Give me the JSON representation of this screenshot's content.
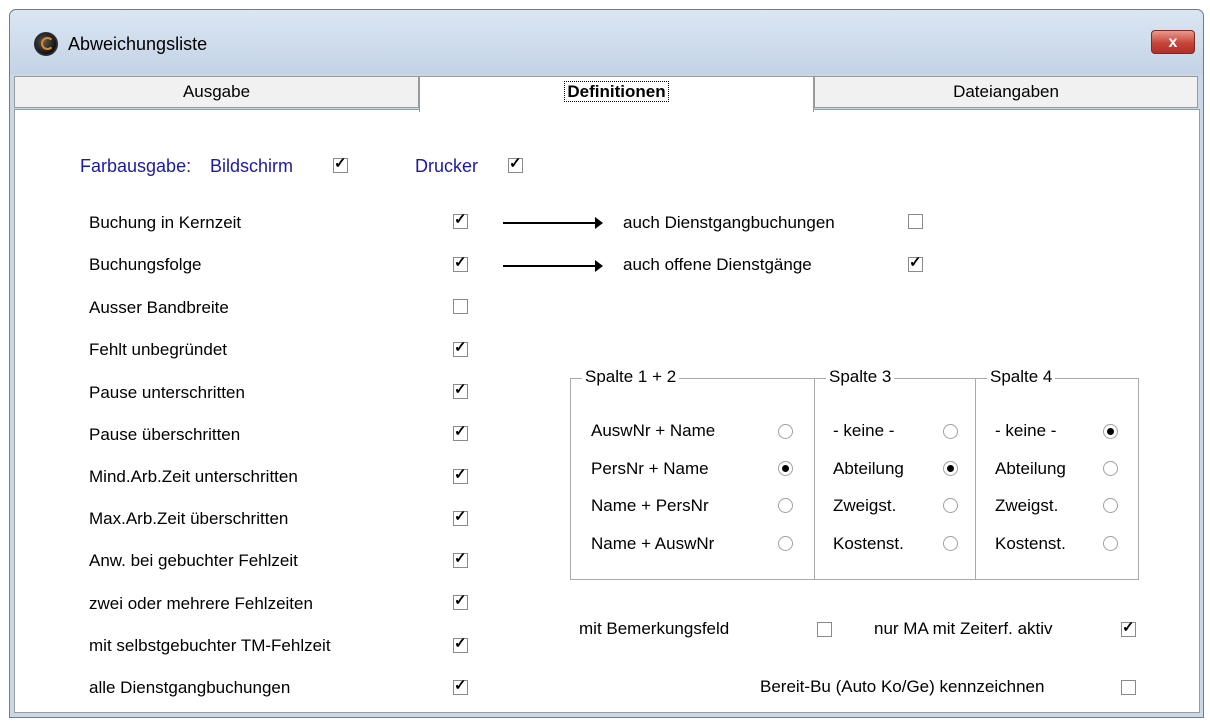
{
  "window": {
    "title": "Abweichungsliste",
    "close_label": "x"
  },
  "tabs": [
    {
      "label": "Ausgabe"
    },
    {
      "label": "Definitionen"
    },
    {
      "label": "Dateiangaben"
    }
  ],
  "farbausgabe": {
    "label": "Farbausgabe:",
    "bildschirm_label": "Bildschirm",
    "bildschirm_checked": true,
    "drucker_label": "Drucker",
    "drucker_checked": true
  },
  "checklist": [
    {
      "label": "Buchung in Kernzeit",
      "checked": true
    },
    {
      "label": "Buchungsfolge",
      "checked": true
    },
    {
      "label": "Ausser Bandbreite",
      "checked": false
    },
    {
      "label": "Fehlt unbegründet",
      "checked": true
    },
    {
      "label": "Pause unterschritten",
      "checked": true
    },
    {
      "label": "Pause überschritten",
      "checked": true
    },
    {
      "label": "Mind.Arb.Zeit unterschritten",
      "checked": true
    },
    {
      "label": "Max.Arb.Zeit überschritten",
      "checked": true
    },
    {
      "label": "Anw. bei gebuchter Fehlzeit",
      "checked": true
    },
    {
      "label": "zwei oder mehrere Fehlzeiten",
      "checked": true
    },
    {
      "label": "mit selbstgebuchter TM-Fehlzeit",
      "checked": true
    },
    {
      "label": "alle Dienstgangbuchungen",
      "checked": true
    }
  ],
  "sub_options": [
    {
      "label": "auch Dienstgangbuchungen",
      "checked": false
    },
    {
      "label": "auch offene Dienstgänge",
      "checked": true
    }
  ],
  "spalte12": {
    "title": "Spalte 1 + 2",
    "options": [
      "AuswNr + Name",
      "PersNr + Name",
      "Name + PersNr",
      "Name + AuswNr"
    ],
    "selected": "PersNr + Name"
  },
  "spalte3": {
    "title": "Spalte 3",
    "options": [
      "- keine -",
      "Abteilung",
      "Zweigst.",
      "Kostenst."
    ],
    "selected": "Abteilung"
  },
  "spalte4": {
    "title": "Spalte 4",
    "options": [
      "- keine -",
      "Abteilung",
      "Zweigst.",
      "Kostenst."
    ],
    "selected": "- keine -"
  },
  "extras": {
    "bemerkung_label": "mit Bemerkungsfeld",
    "bemerkung_checked": false,
    "zeiterf_label": "nur MA mit Zeiterf. aktiv",
    "zeiterf_checked": true,
    "bereit_label": "Bereit-Bu (Auto Ko/Ge) kennzeichnen",
    "bereit_checked": false
  }
}
